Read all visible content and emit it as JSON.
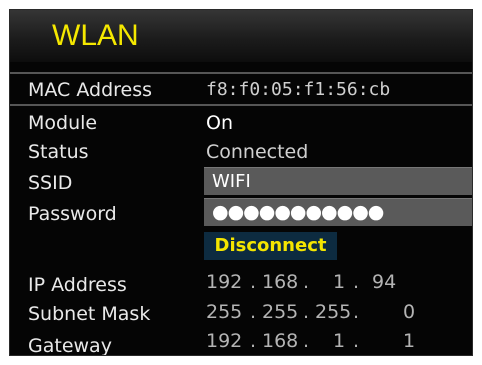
{
  "title": "WLAN",
  "mac": {
    "label": "MAC Address",
    "value": "f8:f0:05:f1:56:cb"
  },
  "module": {
    "label": "Module",
    "value": "On"
  },
  "status": {
    "label": "Status",
    "value": "Connected"
  },
  "ssid": {
    "label": "SSID",
    "value": "WIFI"
  },
  "password": {
    "label": "Password",
    "value": "●●●●●●●●●●●"
  },
  "disconnect_label": "Disconnect",
  "ip_address": {
    "label": "IP Address",
    "octets": [
      "192",
      "168",
      "1",
      "94"
    ],
    "dot": "."
  },
  "subnet_mask": {
    "label": "Subnet Mask",
    "octets": [
      "255",
      "255",
      "255",
      "0"
    ],
    "dot": "."
  },
  "gateway": {
    "label": "Gateway",
    "octets": [
      "192",
      "168",
      "1",
      "1"
    ],
    "dot": "."
  },
  "colors": {
    "title": "#f5e800",
    "button_bg": "#0d2b40",
    "button_text": "#f4e500",
    "field_bg": "#5a5a5a"
  }
}
